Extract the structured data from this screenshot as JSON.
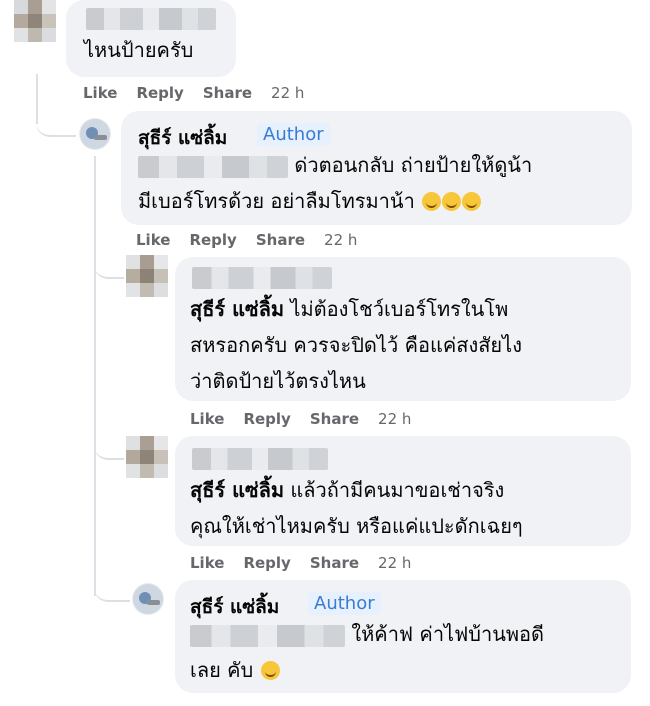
{
  "colors": {
    "bubble": "#f0f2f5",
    "meta": "#65676b",
    "author_badge": "#3a7bd5"
  },
  "comments": [
    {
      "id": "c1",
      "text": "ไหนป้ายครับ",
      "actions": [
        "Like",
        "Reply",
        "Share"
      ],
      "time": "22 h"
    },
    {
      "id": "c2",
      "name": "สุธีร์ แซ่ลิ้ม",
      "badge": "Author",
      "line1": "ด่วตอนกลับ ถ่ายป้ายให้ดูน้า",
      "line2": "มีเบอร์โทรด้วย อย่าลืมโทรมาน้า",
      "actions": [
        "Like",
        "Reply",
        "Share"
      ],
      "time": "22 h"
    },
    {
      "id": "c3",
      "mention": "สุธีร์ แซ่ลิ้ม",
      "line1": "ไม่ต้องโชว์เบอร์โทรในโพ",
      "line2": "สหรอกครับ ควรจะปิดไว้ คือแค่สงสัยไง",
      "line3": "ว่าติดป้ายไว้ตรงไหน",
      "actions": [
        "Like",
        "Reply",
        "Share"
      ],
      "time": "22 h"
    },
    {
      "id": "c4",
      "mention": "สุธีร์ แซ่ลิ้ม",
      "line1": "แล้วถ้ามีคนมาขอเช่าจริง",
      "line2": "คุณให้เช่าไหมครับ หรือแค่แปะดักเฉยๆ",
      "actions": [
        "Like",
        "Reply",
        "Share"
      ],
      "time": "22 h"
    },
    {
      "id": "c5",
      "name": "สุธีร์ แซ่ลิ้ม",
      "badge": "Author",
      "line1": "ให้ค้าฟ ค่าไฟบ้านพอดี",
      "line2": "เลย คับ"
    }
  ]
}
